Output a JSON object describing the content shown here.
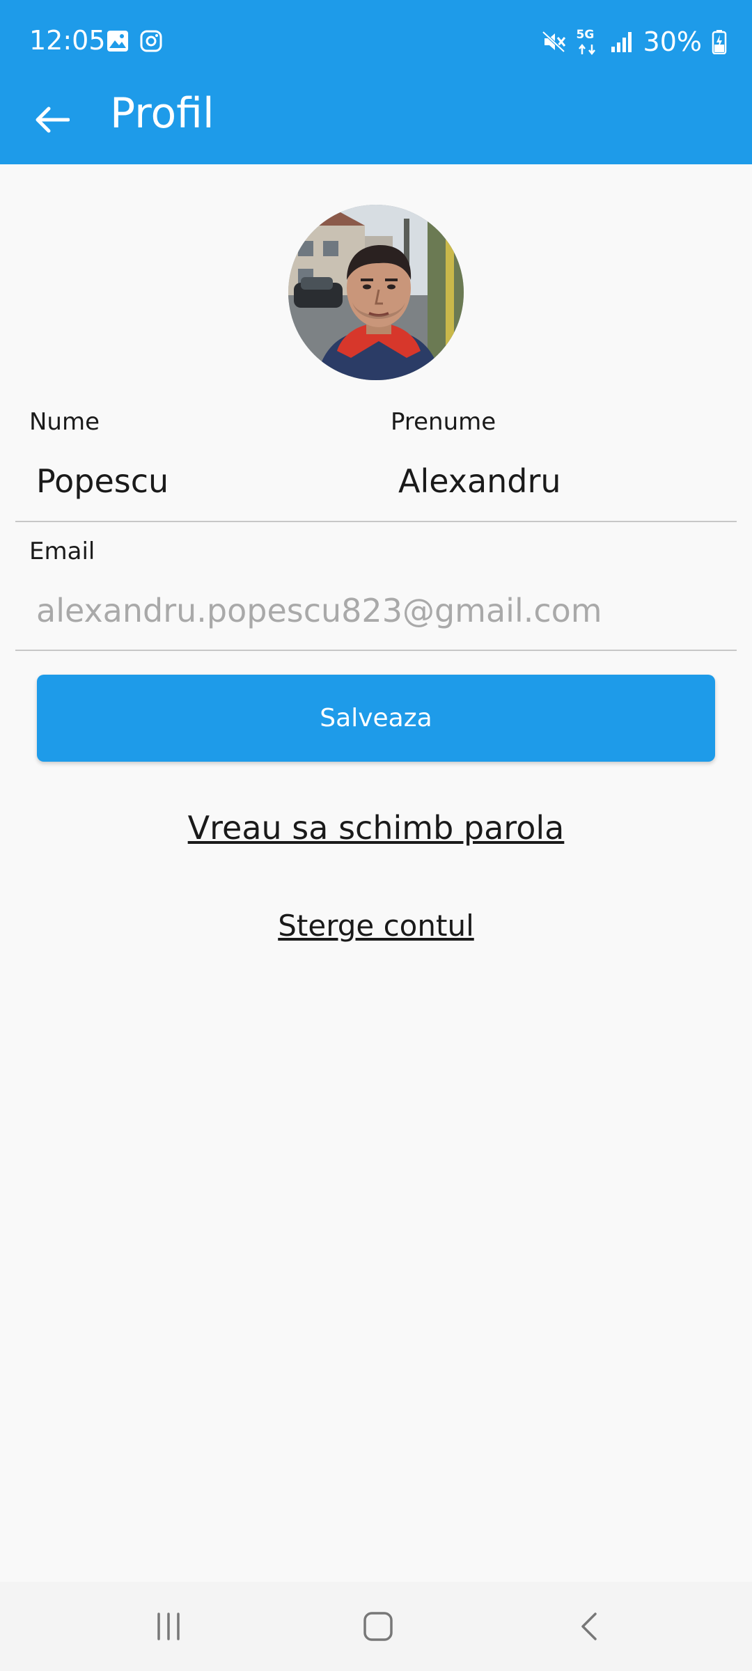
{
  "status_bar": {
    "time": "12:05",
    "battery": "30%",
    "network": "5G"
  },
  "app_bar": {
    "title": "Profil"
  },
  "form": {
    "nume_label": "Nume",
    "nume_value": "Popescu",
    "prenume_label": "Prenume",
    "prenume_value": "Alexandru",
    "email_label": "Email",
    "email_value": "alexandru.popescu823@gmail.com"
  },
  "actions": {
    "save_label": "Salveaza",
    "change_password_label": "Vreau sa schimb parola",
    "delete_account_label": "Sterge contul"
  },
  "colors": {
    "primary": "#1e9be9",
    "background": "#f9f9f9",
    "divider": "#c7c7c7"
  }
}
